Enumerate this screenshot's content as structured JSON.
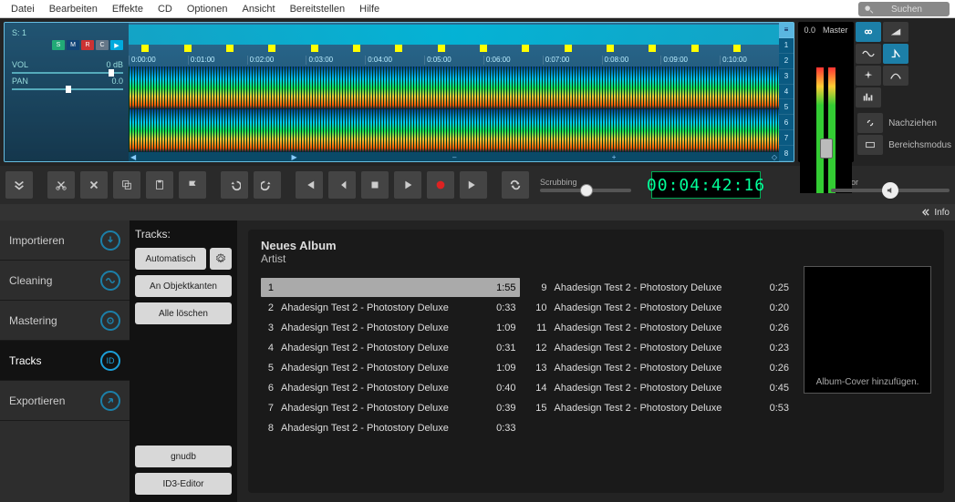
{
  "menu": [
    "Datei",
    "Bearbeiten",
    "Effekte",
    "CD",
    "Optionen",
    "Ansicht",
    "Bereitstellen",
    "Hilfe"
  ],
  "search_placeholder": "Suchen",
  "timeline": {
    "track_label": "S: 1",
    "vol_label": "VOL",
    "vol_value": "0 dB",
    "pan_label": "PAN",
    "pan_value": "0.0",
    "chips": [
      "S",
      "M",
      "R",
      "C",
      "▶"
    ],
    "times": [
      "0:00:00",
      "0:01:00",
      "0:02:00",
      "0:03:00",
      "0:04:00",
      "0:05:00",
      "0:06:00",
      "0:07:00",
      "0:08:00",
      "0:09:00",
      "0:10:00"
    ],
    "vnums": [
      "1",
      "2",
      "3",
      "4",
      "5",
      "6",
      "7",
      "8"
    ],
    "scroll_glyphs": [
      "◀",
      "▶",
      "–",
      "+",
      "◇"
    ]
  },
  "meter": {
    "val": "0.0",
    "label": "Master"
  },
  "modes": {
    "nachziehen": "Nachziehen",
    "bereich": "Bereichsmodus"
  },
  "scrubbing_label": "Scrubbing",
  "monitor_label": "Monitor",
  "timecode": "00:04:42:16",
  "info_label": "Info",
  "sidetabs": [
    {
      "label": "Importieren",
      "icon": "import"
    },
    {
      "label": "Cleaning",
      "icon": "clean"
    },
    {
      "label": "Mastering",
      "icon": "master"
    },
    {
      "label": "Tracks",
      "icon": "id",
      "active": true
    },
    {
      "label": "Exportieren",
      "icon": "export"
    }
  ],
  "trackpanel": {
    "title": "Tracks:",
    "auto": "Automatisch",
    "objkanten": "An Objektkanten",
    "loeschen": "Alle löschen",
    "gnudb": "gnudb",
    "id3": "ID3-Editor"
  },
  "album": {
    "title": "Neues Album",
    "artist": "Artist",
    "cover_hint": "Album-Cover hinzufügen."
  },
  "tracks_left": [
    {
      "n": 1,
      "name": "",
      "dur": "1:55",
      "sel": true
    },
    {
      "n": 2,
      "name": "Ahadesign Test 2 - Photostory Deluxe",
      "dur": "0:33"
    },
    {
      "n": 3,
      "name": "Ahadesign Test 2 - Photostory Deluxe",
      "dur": "1:09"
    },
    {
      "n": 4,
      "name": "Ahadesign Test 2 - Photostory Deluxe",
      "dur": "0:31"
    },
    {
      "n": 5,
      "name": "Ahadesign Test 2 - Photostory Deluxe",
      "dur": "1:09"
    },
    {
      "n": 6,
      "name": "Ahadesign Test 2 - Photostory Deluxe",
      "dur": "0:40"
    },
    {
      "n": 7,
      "name": "Ahadesign Test 2 - Photostory Deluxe",
      "dur": "0:39"
    },
    {
      "n": 8,
      "name": "Ahadesign Test 2 - Photostory Deluxe",
      "dur": "0:33"
    }
  ],
  "tracks_right": [
    {
      "n": 9,
      "name": "Ahadesign Test 2 - Photostory Deluxe",
      "dur": "0:25"
    },
    {
      "n": 10,
      "name": "Ahadesign Test 2 - Photostory Deluxe",
      "dur": "0:20"
    },
    {
      "n": 11,
      "name": "Ahadesign Test 2 - Photostory Deluxe",
      "dur": "0:26"
    },
    {
      "n": 12,
      "name": "Ahadesign Test 2 - Photostory Deluxe",
      "dur": "0:23"
    },
    {
      "n": 13,
      "name": "Ahadesign Test 2 - Photostory Deluxe",
      "dur": "0:26"
    },
    {
      "n": 14,
      "name": "Ahadesign Test 2 - Photostory Deluxe",
      "dur": "0:45"
    },
    {
      "n": 15,
      "name": "Ahadesign Test 2 - Photostory Deluxe",
      "dur": "0:53"
    }
  ]
}
